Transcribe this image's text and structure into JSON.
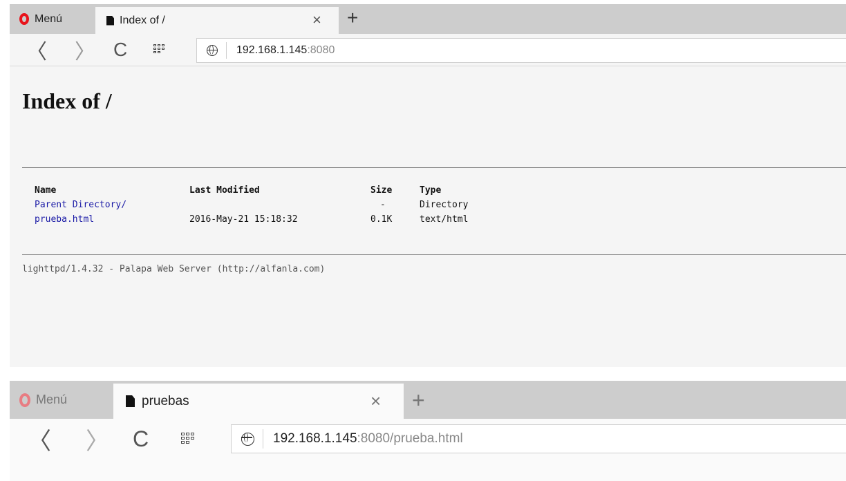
{
  "window1": {
    "menu_label": "Menú",
    "tab_title": "Index of /",
    "close_glyph": "×",
    "newtab_glyph": "+",
    "url_host": "192.168.1.145",
    "url_rest": ":8080",
    "page": {
      "heading": "Index of /",
      "columns": [
        "Name",
        "Last Modified",
        "Size",
        "Type"
      ],
      "rows": [
        {
          "name": "Parent Directory/",
          "modified": "",
          "size": "-",
          "type": "Directory"
        },
        {
          "name": "prueba.html",
          "modified": "2016-May-21 15:18:32",
          "size": "0.1K",
          "type": "text/html"
        }
      ],
      "footer": "lighttpd/1.4.32 - Palapa Web Server (http://alfanla.com)"
    }
  },
  "window2": {
    "menu_label": "Menú",
    "tab_title": "pruebas",
    "close_glyph": "×",
    "newtab_glyph": "+",
    "url_host": "192.168.1.145",
    "url_rest": ":8080/prueba.html"
  },
  "nav": {
    "back": "〈",
    "forward": "〉",
    "reload": "C"
  },
  "colors": {
    "link": "#1a1aa6",
    "opera_red": "#e8131b",
    "tabbar": "#cdcdcd"
  },
  "icons": [
    "opera-logo-icon",
    "document-icon",
    "close-icon",
    "plus-icon",
    "back-icon",
    "forward-icon",
    "reload-icon",
    "speed-dial-icon",
    "globe-icon"
  ]
}
